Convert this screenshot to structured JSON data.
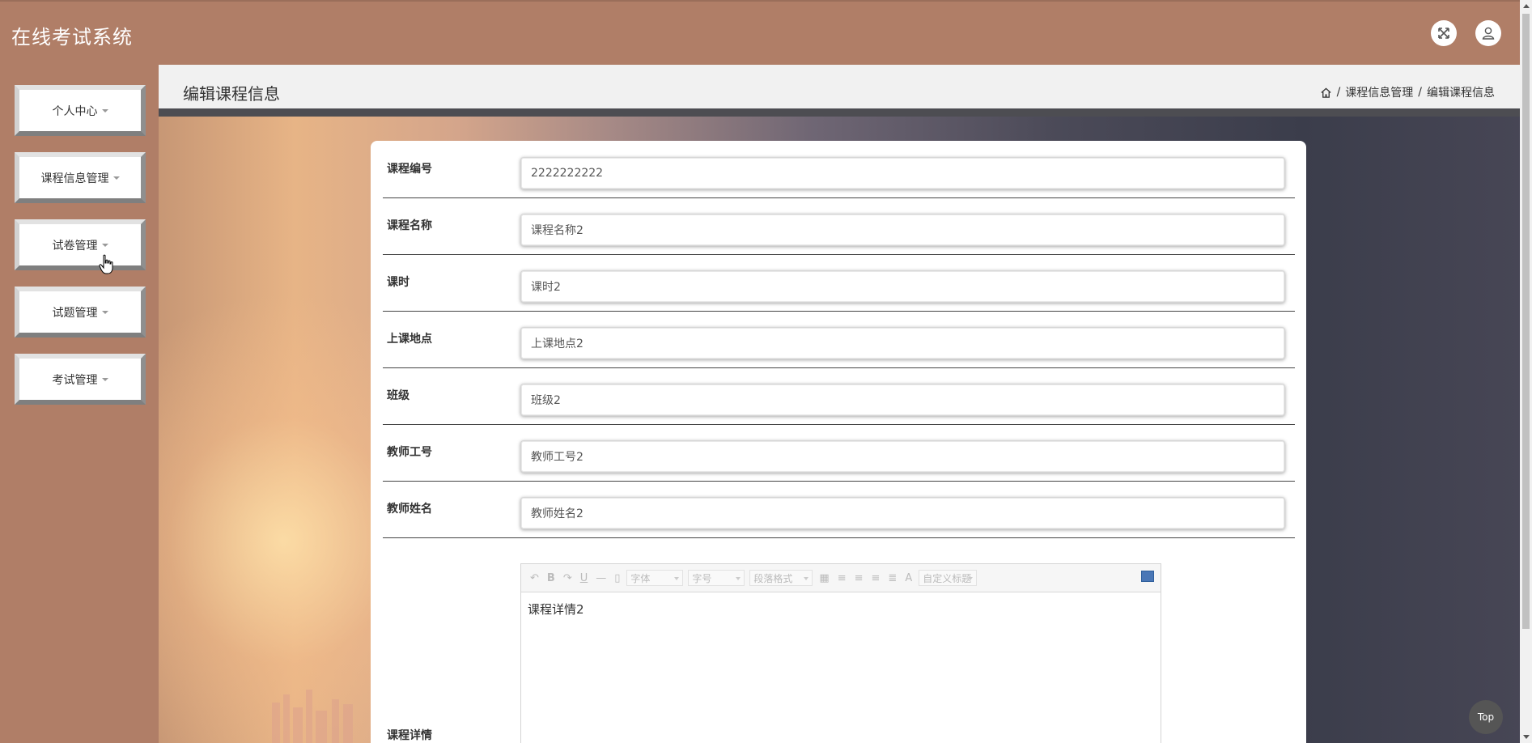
{
  "app": {
    "title": "在线考试系统"
  },
  "header": {
    "icons": [
      "fullscreen-icon",
      "user-icon"
    ]
  },
  "sidebar": {
    "items": [
      {
        "label": "个人中心"
      },
      {
        "label": "课程信息管理"
      },
      {
        "label": "试卷管理"
      },
      {
        "label": "试题管理"
      },
      {
        "label": "考试管理"
      }
    ]
  },
  "page": {
    "title": "编辑课程信息",
    "breadcrumb": [
      "课程信息管理",
      "编辑课程信息"
    ],
    "breadcrumb_sep": "/"
  },
  "form": {
    "fields": [
      {
        "label": "课程编号",
        "value": "2222222222"
      },
      {
        "label": "课程名称",
        "value": "课程名称2"
      },
      {
        "label": "课时",
        "value": "课时2"
      },
      {
        "label": "上课地点",
        "value": "上课地点2"
      },
      {
        "label": "班级",
        "value": "班级2"
      },
      {
        "label": "教师工号",
        "value": "教师工号2"
      },
      {
        "label": "教师姓名",
        "value": "教师姓名2"
      }
    ],
    "detail": {
      "label": "课程详情",
      "content": "课程详情2",
      "toolbar": {
        "font": "字体",
        "size": "字号",
        "paragraph": "段落格式",
        "custom_title": "自定义标题",
        "bold": "B",
        "underline": "U",
        "hr": "—",
        "font_color": "A"
      }
    }
  },
  "back_to_top": "Top",
  "colors": {
    "header": "#b07e67",
    "sidebar": "#b07e67",
    "card": "#ffffff",
    "headbar": "#f1f1f1"
  }
}
